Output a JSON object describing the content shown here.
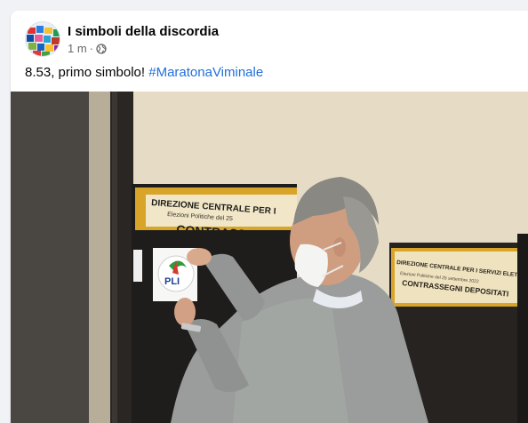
{
  "post": {
    "page_name": "I simboli della discordia",
    "timestamp": "1 m",
    "separator": "·",
    "privacy_icon": "globe-icon",
    "text_prefix": "8.53, primo simbolo! ",
    "hashtag": "#MaratonaViminale"
  },
  "photo": {
    "sign_left_line1": "DIREZIONE CENTRALE PER I",
    "sign_left_line2": "Elezioni Politiche del 25",
    "sign_left_line3": "CONTRASSEGNI",
    "sign_right_line1": "DIREZIONE CENTRALE PER I SERVIZI ELETTORALI",
    "sign_right_line2": "Elezioni Politiche del 25 settembre 2022",
    "sign_right_line3": "CONTRASSEGNI DEPOSITATI",
    "symbol_label": "PLI"
  },
  "colors": {
    "link": "#216fdb",
    "text": "#050505",
    "muted": "#65676b",
    "sign_yellow": "#d9a528"
  }
}
